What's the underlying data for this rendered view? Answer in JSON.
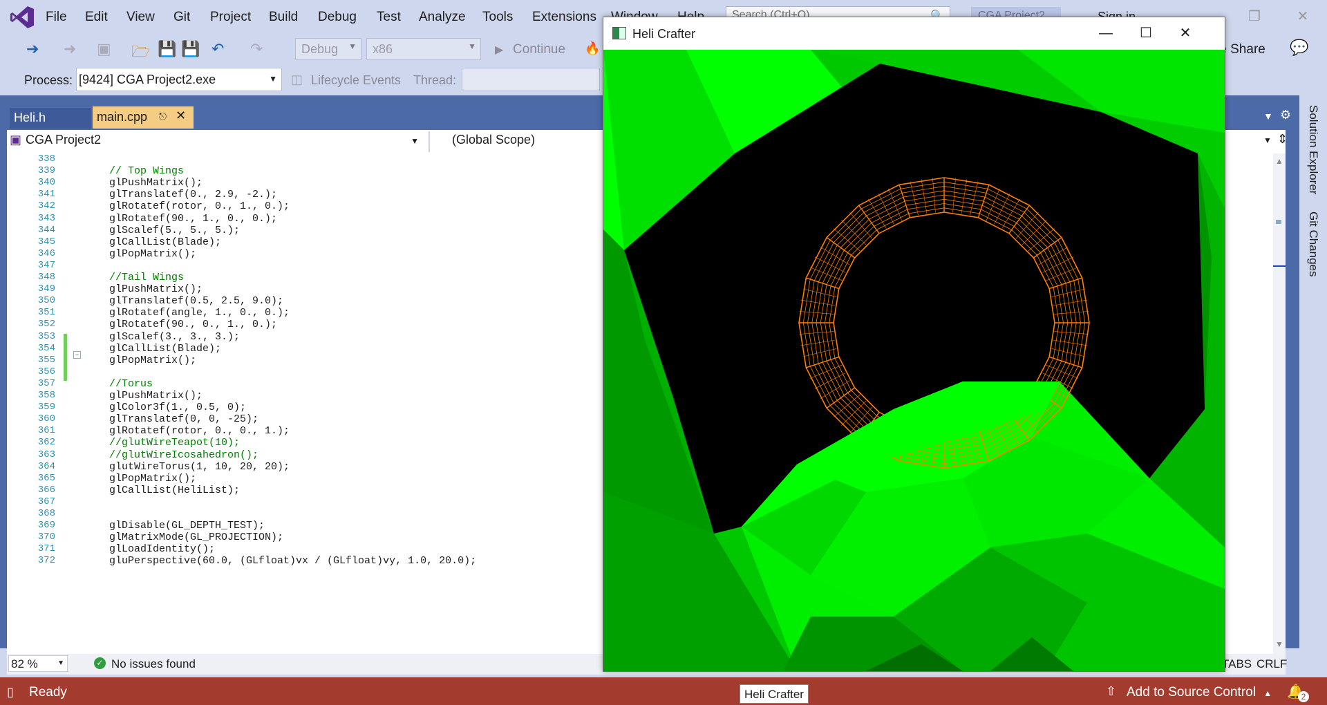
{
  "menu": {
    "items": [
      "File",
      "Edit",
      "View",
      "Git",
      "Project",
      "Build",
      "Debug",
      "Test",
      "Analyze",
      "Tools",
      "Extensions",
      "Window",
      "Help"
    ],
    "search_placeholder": "Search (Ctrl+Q)",
    "project_badge": "CGA Project2",
    "signin": "Sign in"
  },
  "toolbar": {
    "config": "Debug",
    "platform": "x86",
    "continue": "Continue",
    "share": "Live Share"
  },
  "debug_location": {
    "process_label": "Process:",
    "process_value": "[9424] CGA Project2.exe",
    "lifecycle": "Lifecycle Events",
    "thread_label": "Thread:"
  },
  "tabs": {
    "heli": "Heli.h",
    "main": "main.cpp"
  },
  "navbar": {
    "project": "CGA Project2",
    "scope": "(Global Scope)"
  },
  "code_lines": [
    {
      "n": "338",
      "t": ""
    },
    {
      "n": "339",
      "t": "// Top Wings",
      "c": "cmt"
    },
    {
      "n": "340",
      "t": "glPushMatrix();"
    },
    {
      "n": "341",
      "t": "glTranslatef(0., 2.9, -2.);"
    },
    {
      "n": "342",
      "t": "glRotatef(rotor, 0., 1., 0.);"
    },
    {
      "n": "343",
      "t": "glRotatef(90., 1., 0., 0.);"
    },
    {
      "n": "344",
      "t": "glScalef(5., 5., 5.);"
    },
    {
      "n": "345",
      "t": "glCallList(Blade);"
    },
    {
      "n": "346",
      "t": "glPopMatrix();"
    },
    {
      "n": "347",
      "t": ""
    },
    {
      "n": "348",
      "t": "//Tail Wings",
      "c": "cmt"
    },
    {
      "n": "349",
      "t": "glPushMatrix();"
    },
    {
      "n": "350",
      "t": "glTranslatef(0.5, 2.5, 9.0);"
    },
    {
      "n": "351",
      "t": "glRotatef(angle, 1., 0., 0.);"
    },
    {
      "n": "352",
      "t": "glRotatef(90., 0., 1., 0.);"
    },
    {
      "n": "353",
      "t": "glScalef(3., 3., 3.);"
    },
    {
      "n": "354",
      "t": "glCallList(Blade);"
    },
    {
      "n": "355",
      "t": "glPopMatrix();"
    },
    {
      "n": "356",
      "t": ""
    },
    {
      "n": "357",
      "t": "//Torus",
      "c": "cmt"
    },
    {
      "n": "358",
      "t": "glPushMatrix();"
    },
    {
      "n": "359",
      "t": "glColor3f(1., 0.5, 0);"
    },
    {
      "n": "360",
      "t": "glTranslatef(0, 0, -25);"
    },
    {
      "n": "361",
      "t": "glRotatef(rotor, 0., 0., 1.);"
    },
    {
      "n": "362",
      "t": "//glutWireTeapot(10);",
      "c": "cmt"
    },
    {
      "n": "363",
      "t": "//glutWireIcosahedron();",
      "c": "cmt"
    },
    {
      "n": "364",
      "t": "glutWireTorus(1, 10, 20, 20);"
    },
    {
      "n": "365",
      "t": "glPopMatrix();"
    },
    {
      "n": "366",
      "t": "glCallList(HeliList);"
    },
    {
      "n": "367",
      "t": ""
    },
    {
      "n": "368",
      "t": ""
    },
    {
      "n": "369",
      "t": "glDisable(GL_DEPTH_TEST);"
    },
    {
      "n": "370",
      "t": "glMatrixMode(GL_PROJECTION);"
    },
    {
      "n": "371",
      "t": "glLoadIdentity();"
    },
    {
      "n": "372",
      "t": "gluPerspective(60.0, (GLfloat)vx / (GLfloat)vy, 1.0, 20.0);"
    }
  ],
  "editor_status": {
    "zoom": "82 %",
    "issues": "No issues found",
    "tabs": "TABS",
    "line_ending": "CRLF"
  },
  "right_rail": {
    "solution_explorer": "Solution Explorer",
    "git_changes": "Git Changes"
  },
  "statusbar": {
    "ready": "Ready",
    "source_control": "Add to Source Control",
    "notifications": "2"
  },
  "taskbar_tooltip": "Heli Crafter",
  "gl_window": {
    "title": "Heli Crafter",
    "colors": {
      "bright_green": "#00ff00",
      "mid_green": "#00cc00",
      "dark_green": "#009900",
      "torus": "#ff8000",
      "background": "#000000"
    }
  }
}
